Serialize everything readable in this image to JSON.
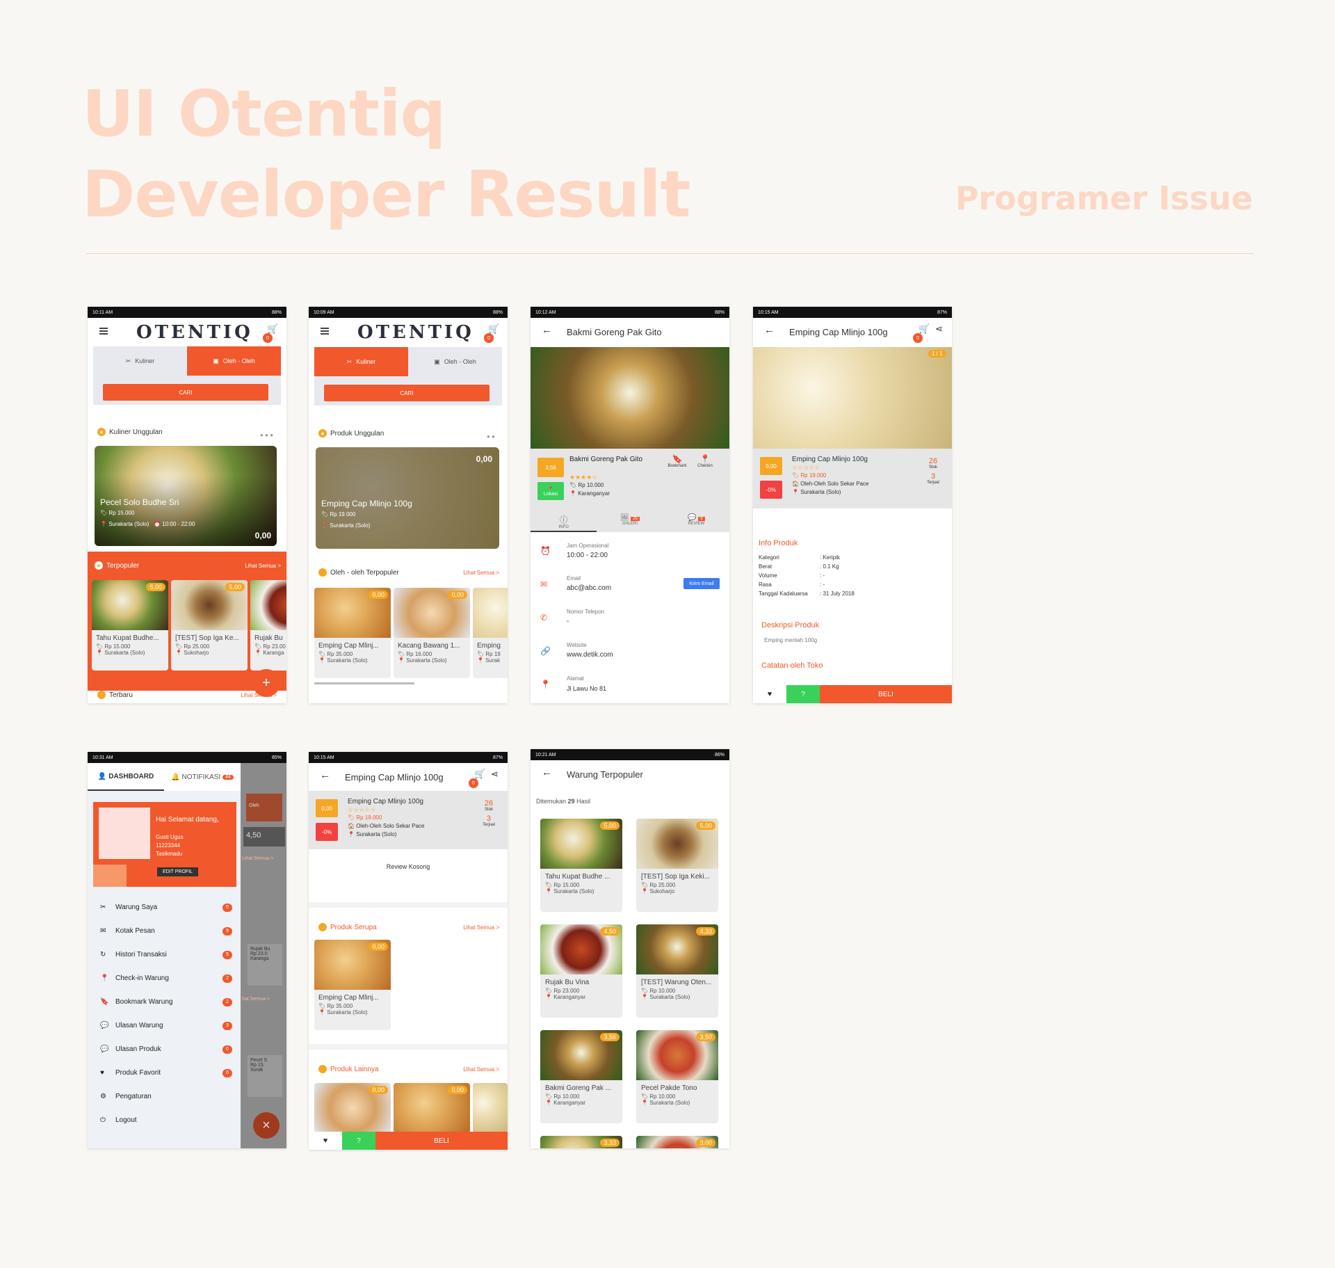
{
  "hero": {
    "line1": "UI Otentiq",
    "line2": "Developer Result",
    "issue": "Programer Issue"
  },
  "colors": {
    "accent": "#f1582b",
    "rating": "#f5a623",
    "discount": "#f2423f",
    "help": "#3ad15a",
    "hero": "#fdd7c3"
  },
  "common": {
    "brand": "OTENTIQ",
    "cart_count": "0",
    "buy": "BELI",
    "see_all": "Lihat Semua >",
    "price_icon": "tag-icon",
    "location_icon": "map-pin-icon"
  },
  "s1": {
    "time": "10:11 AM",
    "battery": "88%",
    "tab1": "Kuliner",
    "tab2": "Oleh - Oleh",
    "search": "CARI",
    "featured_title": "Kuliner Unggulan",
    "banner": {
      "name": "Pecel Solo Budhe Sri",
      "price": "Rp 15.000",
      "location": "Surakarta (Solo)",
      "hours": "10:00 - 22:00",
      "rating": "0,00"
    },
    "popular_title": "Terpopuler",
    "cards": [
      {
        "name": "Tahu Kupat Budhe...",
        "price": "Rp 15.000",
        "location": "Surakarta (Solo)",
        "rating": "5,00"
      },
      {
        "name": "[TEST] Sop Iga Ke...",
        "price": "Rp 25.000",
        "location": "Sukoharjo",
        "rating": "5,00"
      },
      {
        "name": "Rujak Bu",
        "price": "Rp 23.00",
        "location": "Karanga"
      }
    ],
    "latest_title": "Terbaru",
    "fab": "+"
  },
  "s2": {
    "time": "10:09 AM",
    "battery": "88%",
    "tab1": "Kuliner",
    "tab2": "Oleh - Oleh",
    "search": "CARI",
    "featured_title": "Produk Unggulan",
    "banner": {
      "name": "Emping Cap Mlinjo 100g",
      "price": "Rp 19.000",
      "location": "Surakarta (Solo)",
      "rating": "0,00"
    },
    "popular_title": "Oleh - oleh Terpopuler",
    "cards": [
      {
        "name": "Emping Cap Mlinj...",
        "price": "Rp 35.000",
        "location": "Surakarta (Solo)",
        "rating": "0,00"
      },
      {
        "name": "Kacang Bawang 1...",
        "price": "Rp 16.000",
        "location": "Surakarta (Solo)",
        "rating": "0,00"
      },
      {
        "name": "Emping",
        "price": "Rp 19",
        "location": "Surak"
      }
    ]
  },
  "s3": {
    "time": "10:12 AM",
    "battery": "88%",
    "title": "Bakmi Goreng Pak Gito",
    "rating": "3,56",
    "name": "Bakmi Goreng Pak Gito",
    "price": "Rp 10.000",
    "location": "Karanganyar",
    "lokasi": "Lokasi",
    "bookmark": "Bookmark",
    "checkin": "Checkin",
    "tabs": {
      "info": "INFO",
      "galeri": "GALERI",
      "review": "REVIEW",
      "galeri_count": "25",
      "review_count": "9"
    },
    "hours_label": "Jam Operasional",
    "hours": "10:00 - 22:00",
    "email_label": "Email",
    "email": "abc@abc.com",
    "send_email": "Kirim Email",
    "phone_label": "Nomor Telepon",
    "phone": "-",
    "website_label": "Website",
    "website": "www.detik.com",
    "address_label": "Alamat",
    "address": "Jl Lawu No 81"
  },
  "s4": {
    "time": "10:15 AM",
    "battery": "87%",
    "title": "Emping Cap Mlinjo 100g",
    "counter": "1 / 1",
    "rating": "0,00",
    "discount": "-0%",
    "name": "Emping Cap Mlinjo 100g",
    "price": "Rp 19.000",
    "store": "Oleh-Oleh Solo Sekar Pace",
    "location": "Surakarta (Solo)",
    "stock": "26",
    "stock_label": "Stok",
    "sold": "3",
    "sold_label": "Terjual",
    "info_title": "Info Produk",
    "info": [
      {
        "k": "Kategori",
        "v": ": Keripik"
      },
      {
        "k": "Berat",
        "v": ": 0.1 Kg"
      },
      {
        "k": "Volume",
        "v": ": -"
      },
      {
        "k": "Rasa",
        "v": ": -"
      },
      {
        "k": "Tanggal Kadaluarsa",
        "v": ": 31 July 2018"
      }
    ],
    "desc_title": "Deskripsi Produk",
    "desc": "Emping mentah 100g",
    "note_title": "Catatan oleh Toko"
  },
  "s5": {
    "time": "10:31 AM",
    "battery": "85%",
    "tab_dashboard": "DASHBOARD",
    "tab_notif": "NOTIFIKASI",
    "notif_count": "44",
    "greeting": "Hai Selamat datang,",
    "user_name": "Gusti Ugus",
    "user_phone": "11223344",
    "user_city": "Tasikmadu",
    "edit": "EDIT PROFIL",
    "menu": [
      {
        "label": "Warung Saya",
        "count": "0",
        "icon": "fork-knife-icon"
      },
      {
        "label": "Kotak Pesan",
        "count": "9",
        "icon": "mail-icon"
      },
      {
        "label": "Histori Transaksi",
        "count": "5",
        "icon": "history-icon"
      },
      {
        "label": "Check-in Warung",
        "count": "2",
        "icon": "map-pin-icon"
      },
      {
        "label": "Bookmark Warung",
        "count": "2",
        "icon": "bookmark-icon"
      },
      {
        "label": "Ulasan Warung",
        "count": "3",
        "icon": "comment-icon"
      },
      {
        "label": "Ulasan Produk",
        "count": "0",
        "icon": "comment-icon"
      },
      {
        "label": "Produk Favorit",
        "count": "0",
        "icon": "heart-icon"
      },
      {
        "label": "Pengaturan",
        "icon": "gear-icon"
      },
      {
        "label": "Logout",
        "icon": "logout-icon"
      }
    ],
    "bg": {
      "oleh": "Oleh",
      "rating": "4,50",
      "see_all1": "Lihat Semua >",
      "rujak": "Rujak Bu",
      "rujak_price": "Rp 23.0",
      "rujak_loc": "Karanga",
      "see_all2": "hat Semua >",
      "pecel": "Pecel S",
      "pecel_price": "Rp 15.",
      "pecel_loc": "Surak",
      "close": "×"
    }
  },
  "s6": {
    "time": "10:15 AM",
    "battery": "87%",
    "title": "Emping Cap Mlinjo 100g",
    "rating": "0,00",
    "discount": "-0%",
    "name": "Emping Cap Mlinjo 100g",
    "price": "Rp 19.000",
    "store": "Oleh-Oleh Solo Sekar Pace",
    "location": "Surakarta (Solo)",
    "stock": "26",
    "stock_label": "Stok",
    "sold": "3",
    "sold_label": "Terjual",
    "empty_review": "Review Kosong",
    "similar_title": "Produk Serupa",
    "similar_card": {
      "name": "Emping Cap Mlinj...",
      "price": "Rp 35.000",
      "location": "Surakarta (Solo)",
      "rating": "0,00"
    },
    "other_title": "Produk Lainnya",
    "other_ratings": [
      "0,00",
      "0,00"
    ]
  },
  "s7": {
    "time": "10:21 AM",
    "battery": "86%",
    "title": "Warung Terpopuler",
    "found_prefix": "Ditemukan",
    "found_count": "29",
    "found_suffix": "Hasil",
    "items": [
      {
        "name": "Tahu Kupat Budhe ...",
        "price": "Rp 15.000",
        "location": "Surakarta (Solo)",
        "rating": "5,00"
      },
      {
        "name": "[TEST] Sop Iga Keki...",
        "price": "Rp 25.000",
        "location": "Sukoharjo",
        "rating": "5,00"
      },
      {
        "name": "Rujak Bu Vina",
        "price": "Rp 23.000",
        "location": "Karanganyar",
        "rating": "4,50"
      },
      {
        "name": "[TEST] Warung Oten...",
        "price": "Rp 10.000",
        "location": "Surakarta (Solo)",
        "rating": "4,33"
      },
      {
        "name": "Bakmi Goreng Pak ...",
        "price": "Rp 10.000",
        "location": "Karanganyar",
        "rating": "3,56"
      },
      {
        "name": "Pecel Pakde Tono",
        "price": "Rp 10.000",
        "location": "Surakarta (Solo)",
        "rating": "3,50"
      }
    ],
    "partial_ratings": [
      "3,33",
      "3,00"
    ]
  }
}
